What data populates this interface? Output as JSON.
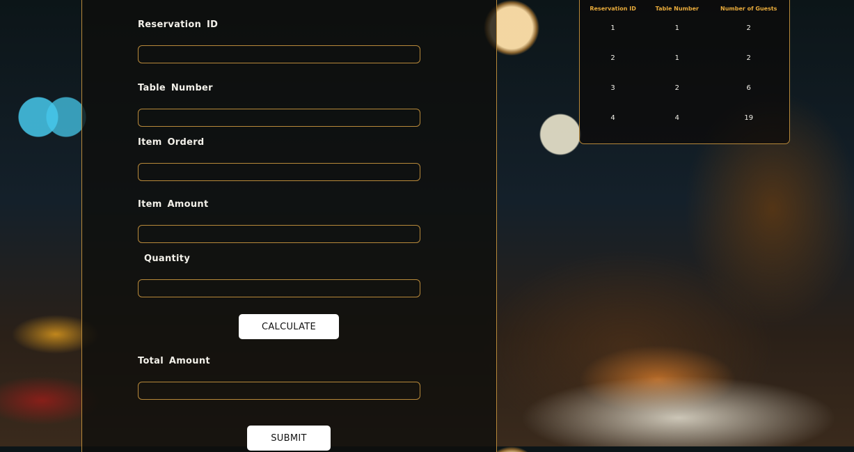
{
  "form": {
    "fields": [
      {
        "label": "Reservation  ID",
        "value": "",
        "placeholder": ""
      },
      {
        "label": "Table  Number",
        "value": "",
        "placeholder": ""
      },
      {
        "label": "Item  Orderd",
        "value": "",
        "placeholder": ""
      },
      {
        "label": "Item  Amount",
        "value": "",
        "placeholder": ""
      },
      {
        "label": "Quantity",
        "value": "",
        "placeholder": ""
      },
      {
        "label": "Total  Amount",
        "value": "",
        "placeholder": ""
      }
    ],
    "calculate_label": "CALCULATE",
    "submit_label": "SUBMIT"
  },
  "reservations": {
    "columns": [
      "Reservation ID",
      "Table Number",
      "Number of Guests"
    ],
    "rows": [
      [
        "1",
        "1",
        "2"
      ],
      [
        "2",
        "1",
        "2"
      ],
      [
        "3",
        "2",
        "6"
      ],
      [
        "4",
        "4",
        "19"
      ]
    ]
  },
  "colors": {
    "accent_border": "#b8893a",
    "table_header": "#e9ab3b",
    "button_bg": "#ffffff"
  }
}
